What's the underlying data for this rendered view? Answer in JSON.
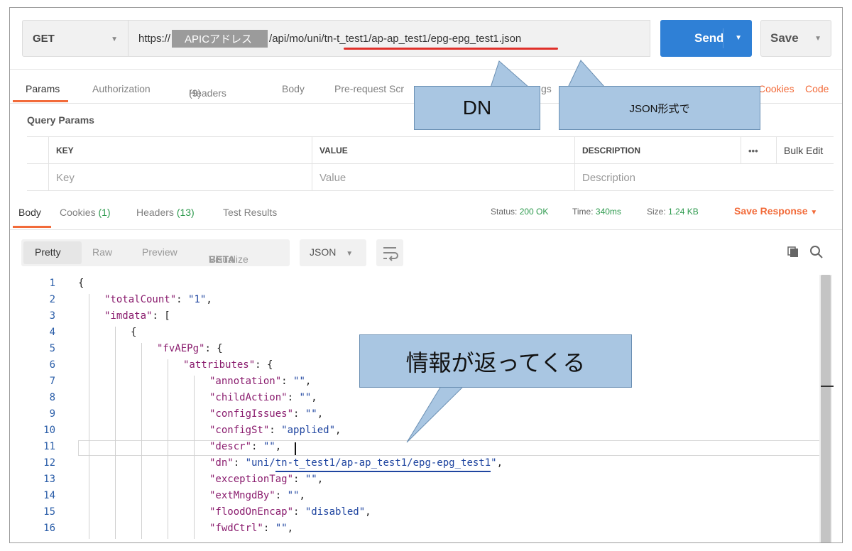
{
  "request": {
    "method": "GET",
    "url_prefix": "https://",
    "url_mask_label": "APICアドレス",
    "url_path": "/api/mo/uni/tn-t_test1/ap-ap_test1/epg-epg_test1.json",
    "send_label": "Send",
    "save_label": "Save"
  },
  "request_tabs": {
    "params": "Params",
    "authorization": "Authorization",
    "headers": "Headers",
    "headers_count": "(9)",
    "body": "Body",
    "prerequest": "Pre-request Scr",
    "tests_partial": "gs",
    "cookies": "Cookies",
    "code": "Code"
  },
  "query_params": {
    "title": "Query Params",
    "columns": [
      "KEY",
      "VALUE",
      "DESCRIPTION"
    ],
    "more": "•••",
    "bulk_edit": "Bulk Edit",
    "placeholders": [
      "Key",
      "Value",
      "Description"
    ]
  },
  "response_tabs": {
    "body": "Body",
    "cookies": "Cookies",
    "cookies_count": "(1)",
    "headers": "Headers",
    "headers_count": "(13)",
    "test_results": "Test Results",
    "status_label": "Status:",
    "status_value": "200 OK",
    "time_label": "Time:",
    "time_value": "340ms",
    "size_label": "Size:",
    "size_value": "1.24 KB",
    "save_response": "Save Response"
  },
  "response_toolbar": {
    "views": [
      "Pretty",
      "Raw",
      "Preview",
      "Visualize"
    ],
    "beta": "BETA",
    "format": "JSON"
  },
  "code_lines": [
    {
      "n": "1",
      "indent": 0,
      "parts": [
        [
          "p",
          "{"
        ]
      ]
    },
    {
      "n": "2",
      "indent": 1,
      "parts": [
        [
          "k",
          "\"totalCount\""
        ],
        [
          "p",
          ": "
        ],
        [
          "s",
          "\"1\""
        ],
        [
          "p",
          ","
        ]
      ]
    },
    {
      "n": "3",
      "indent": 1,
      "parts": [
        [
          "k",
          "\"imdata\""
        ],
        [
          "p",
          ": ["
        ]
      ]
    },
    {
      "n": "4",
      "indent": 2,
      "parts": [
        [
          "p",
          "{"
        ]
      ]
    },
    {
      "n": "5",
      "indent": 3,
      "parts": [
        [
          "k",
          "\"fvAEPg\""
        ],
        [
          "p",
          ": {"
        ]
      ]
    },
    {
      "n": "6",
      "indent": 4,
      "parts": [
        [
          "k",
          "\"attributes\""
        ],
        [
          "p",
          ": {"
        ]
      ]
    },
    {
      "n": "7",
      "indent": 5,
      "parts": [
        [
          "k",
          "\"annotation\""
        ],
        [
          "p",
          ": "
        ],
        [
          "s",
          "\"\""
        ],
        [
          "p",
          ","
        ]
      ]
    },
    {
      "n": "8",
      "indent": 5,
      "parts": [
        [
          "k",
          "\"childAction\""
        ],
        [
          "p",
          ": "
        ],
        [
          "s",
          "\"\""
        ],
        [
          "p",
          ","
        ]
      ]
    },
    {
      "n": "9",
      "indent": 5,
      "parts": [
        [
          "k",
          "\"configIssues\""
        ],
        [
          "p",
          ": "
        ],
        [
          "s",
          "\"\""
        ],
        [
          "p",
          ","
        ]
      ]
    },
    {
      "n": "10",
      "indent": 5,
      "parts": [
        [
          "k",
          "\"configSt\""
        ],
        [
          "p",
          ": "
        ],
        [
          "s",
          "\"applied\""
        ],
        [
          "p",
          ","
        ]
      ]
    },
    {
      "n": "11",
      "indent": 5,
      "parts": [
        [
          "k",
          "\"descr\""
        ],
        [
          "p",
          ": "
        ],
        [
          "s",
          "\"\""
        ],
        [
          "p",
          ","
        ]
      ]
    },
    {
      "n": "12",
      "indent": 5,
      "parts": [
        [
          "k",
          "\"dn\""
        ],
        [
          "p",
          ": "
        ],
        [
          "s",
          "\"uni/tn-t_test1/ap-ap_test1/epg-epg_test1\""
        ],
        [
          "p",
          ","
        ]
      ]
    },
    {
      "n": "13",
      "indent": 5,
      "parts": [
        [
          "k",
          "\"exceptionTag\""
        ],
        [
          "p",
          ": "
        ],
        [
          "s",
          "\"\""
        ],
        [
          "p",
          ","
        ]
      ]
    },
    {
      "n": "14",
      "indent": 5,
      "parts": [
        [
          "k",
          "\"extMngdBy\""
        ],
        [
          "p",
          ": "
        ],
        [
          "s",
          "\"\""
        ],
        [
          "p",
          ","
        ]
      ]
    },
    {
      "n": "15",
      "indent": 5,
      "parts": [
        [
          "k",
          "\"floodOnEncap\""
        ],
        [
          "p",
          ": "
        ],
        [
          "s",
          "\"disabled\""
        ],
        [
          "p",
          ","
        ]
      ]
    },
    {
      "n": "16",
      "indent": 5,
      "parts": [
        [
          "k",
          "\"fwdCtrl\""
        ],
        [
          "p",
          ": "
        ],
        [
          "s",
          "\"\""
        ],
        [
          "p",
          ","
        ]
      ]
    }
  ],
  "callouts": {
    "dn": "DN",
    "json_format": "JSON形式で",
    "info_returns": "情報が返ってくる"
  },
  "colors": {
    "accent_orange": "#f26b3a",
    "send_blue": "#2f80d6",
    "status_green": "#2e9a4e",
    "callout_fill": "#a9c6e2",
    "red_underline": "#e0302a"
  }
}
